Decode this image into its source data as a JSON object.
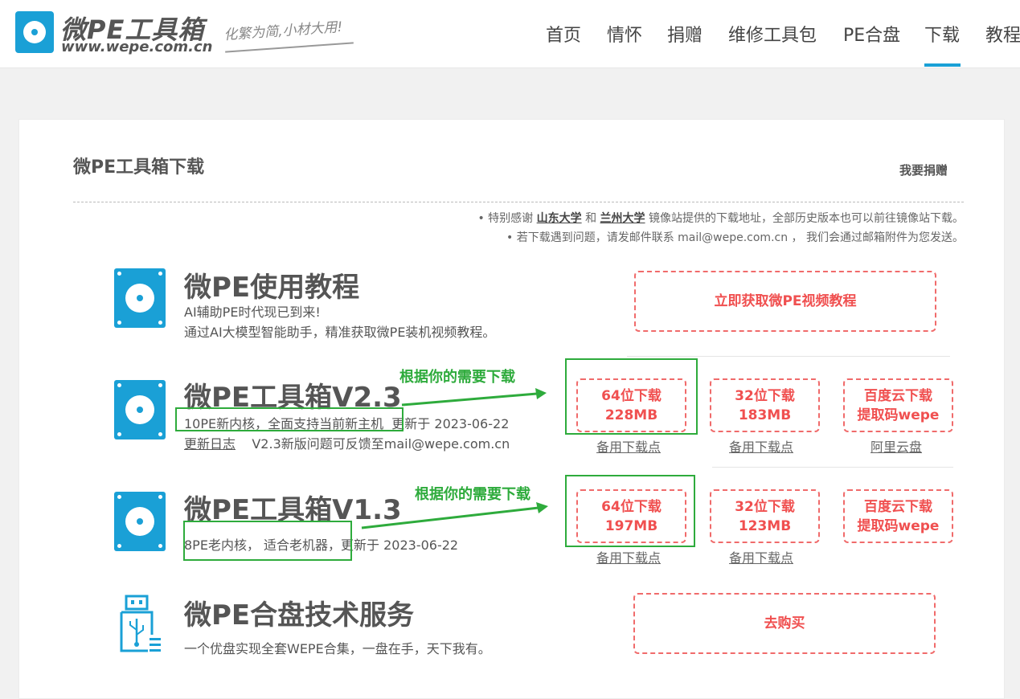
{
  "header": {
    "logo_title": "微PE工具箱",
    "logo_url": "www.wepe.com.cn",
    "slogan": "化繁为简,小材大用!",
    "nav": [
      "首页",
      "情怀",
      "捐赠",
      "维修工具包",
      "PE合盘",
      "下载",
      "教程"
    ],
    "active_nav": "下载"
  },
  "page": {
    "title": "微PE工具箱下载",
    "donate_label": "我要捐赠",
    "notice1_pre": "• 特别感谢 ",
    "notice1_u1": "山东大学",
    "notice1_mid": " 和 ",
    "notice1_u2": "兰州大学",
    "notice1_post": " 镜像站提供的下载地址，全部历史版本也可以前往镜像站下载。",
    "notice2": "• 若下载遇到问题，请发邮件联系 mail@wepe.com.cn ， 我们会通过邮箱附件为您发送。"
  },
  "tutorial": {
    "title": "微PE使用教程",
    "line1": "AI辅助PE时代现已到来!",
    "line2": "通过AI大模型智能助手，精准获取微PE装机视频教程。",
    "button": "立即获取微PE视频教程"
  },
  "v23": {
    "title": "微PE工具箱V2.3",
    "kernel": "10PE新内核，全面支持当前新主机",
    "updated": "更新于 2023-06-22",
    "changelog": "更新日志",
    "feedback": "V2.3新版问题可反馈至mail@wepe.com.cn",
    "annotation": "根据你的需要下载",
    "btn64_l1": "64位下载",
    "btn64_l2": "228MB",
    "btn32_l1": "32位下载",
    "btn32_l2": "183MB",
    "btnbd_l1": "百度云下载",
    "btnbd_l2": "提取码wepe",
    "mirror1": "备用下载点",
    "mirror2": "备用下载点",
    "mirror3": "阿里云盘"
  },
  "v13": {
    "title": "微PE工具箱V1.3",
    "kernel": "8PE老内核， 适合老机器，",
    "updated": "更新于 2023-06-22",
    "annotation": "根据你的需要下载",
    "btn64_l1": "64位下载",
    "btn64_l2": "197MB",
    "btn32_l1": "32位下载",
    "btn32_l2": "123MB",
    "btnbd_l1": "百度云下载",
    "btnbd_l2": "提取码wepe",
    "mirror1": "备用下载点",
    "mirror2": "备用下载点"
  },
  "service": {
    "title": "微PE合盘技术服务",
    "line1": "一个优盘实现全套WEPE合集，一盘在手，天下我有。",
    "button": "去购买"
  },
  "colors": {
    "brand": "#1aa0d6",
    "red_dashed": "#f06b6b",
    "green_annotation": "#2eab3c"
  }
}
